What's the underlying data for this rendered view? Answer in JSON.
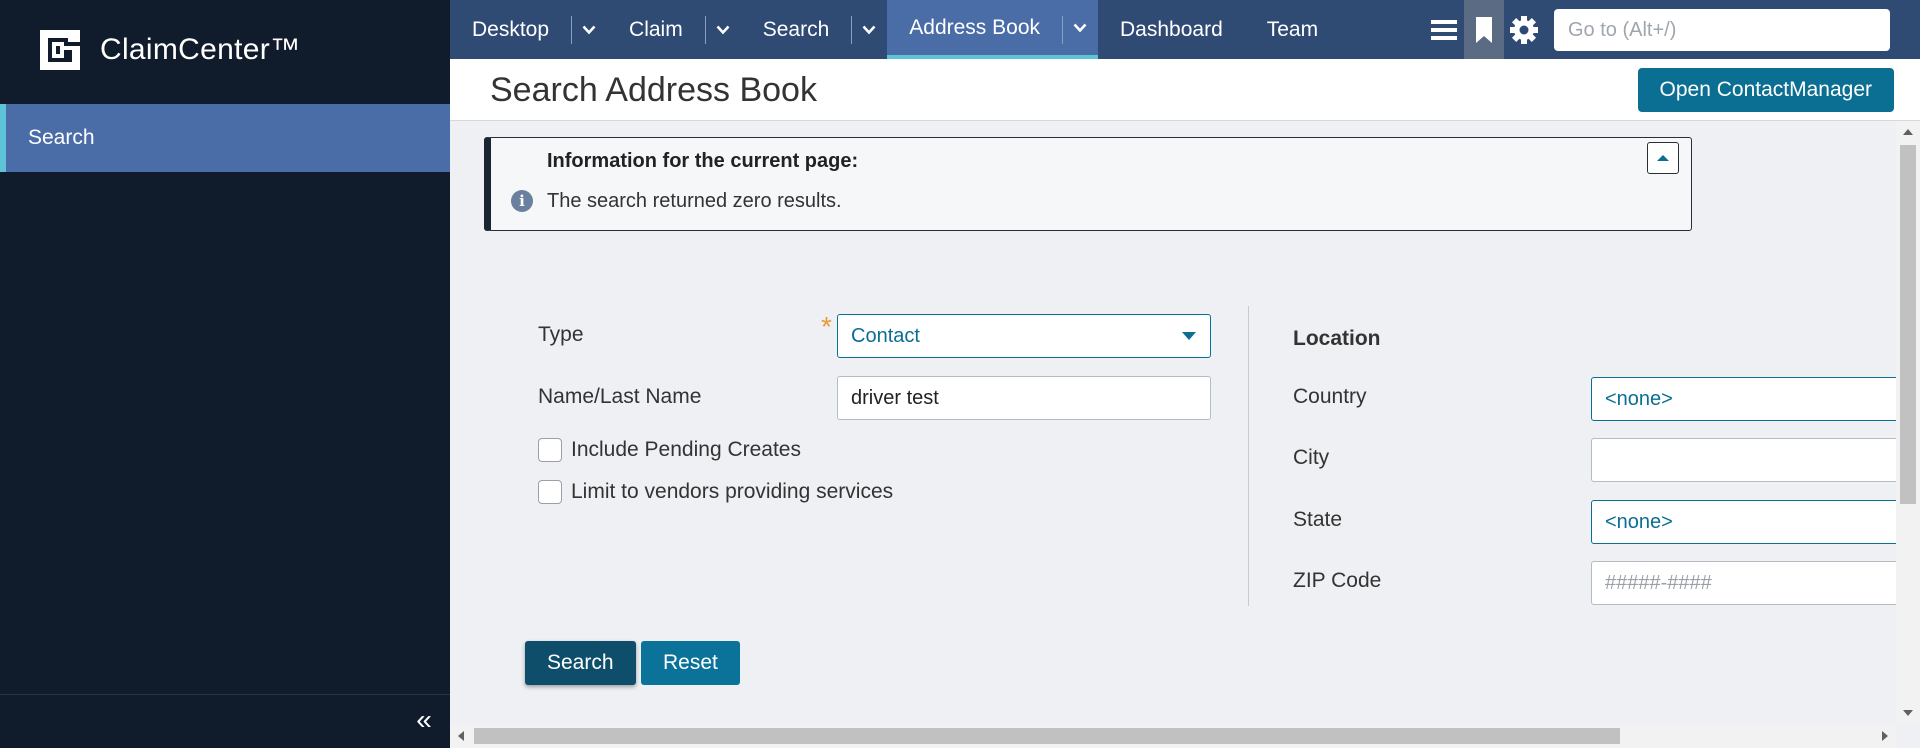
{
  "brand": {
    "name": "ClaimCenter™"
  },
  "sidebar": {
    "items": [
      {
        "label": "Search"
      }
    ],
    "collapse_icon": "double-chevron-left-icon"
  },
  "topnav": {
    "tabs": [
      {
        "label": "Desktop",
        "has_dropdown": true
      },
      {
        "label": "Claim",
        "has_dropdown": true
      },
      {
        "label": "Search",
        "has_dropdown": true
      },
      {
        "label": "Address Book",
        "has_dropdown": true,
        "active": true
      },
      {
        "label": "Dashboard",
        "has_dropdown": false
      },
      {
        "label": "Team",
        "has_dropdown": false
      }
    ],
    "icons": [
      "menu-icon",
      "bookmark-icon",
      "gear-icon"
    ],
    "goto_placeholder": "Go to (Alt+/)"
  },
  "header": {
    "title": "Search Address Book",
    "open_contact_manager": "Open ContactManager"
  },
  "info": {
    "title": "Information for the current page:",
    "message": "The search returned zero results."
  },
  "form": {
    "type_label": "Type",
    "type_value": "Contact",
    "name_label": "Name/Last Name",
    "name_value": "driver test",
    "include_pending_label": "Include Pending Creates",
    "limit_vendors_label": "Limit to vendors providing services"
  },
  "location": {
    "section_label": "Location",
    "country_label": "Country",
    "country_value": "<none>",
    "city_label": "City",
    "city_value": "",
    "state_label": "State",
    "state_value": "<none>",
    "zip_label": "ZIP Code",
    "zip_placeholder": "#####-####"
  },
  "buttons": {
    "search": "Search",
    "reset": "Reset"
  },
  "colors": {
    "sidebar": "#101b2b",
    "topnav": "#2f4a73",
    "active_tab": "#4a6da7",
    "accent": "#0b6e93",
    "required": "#e89a3c"
  }
}
